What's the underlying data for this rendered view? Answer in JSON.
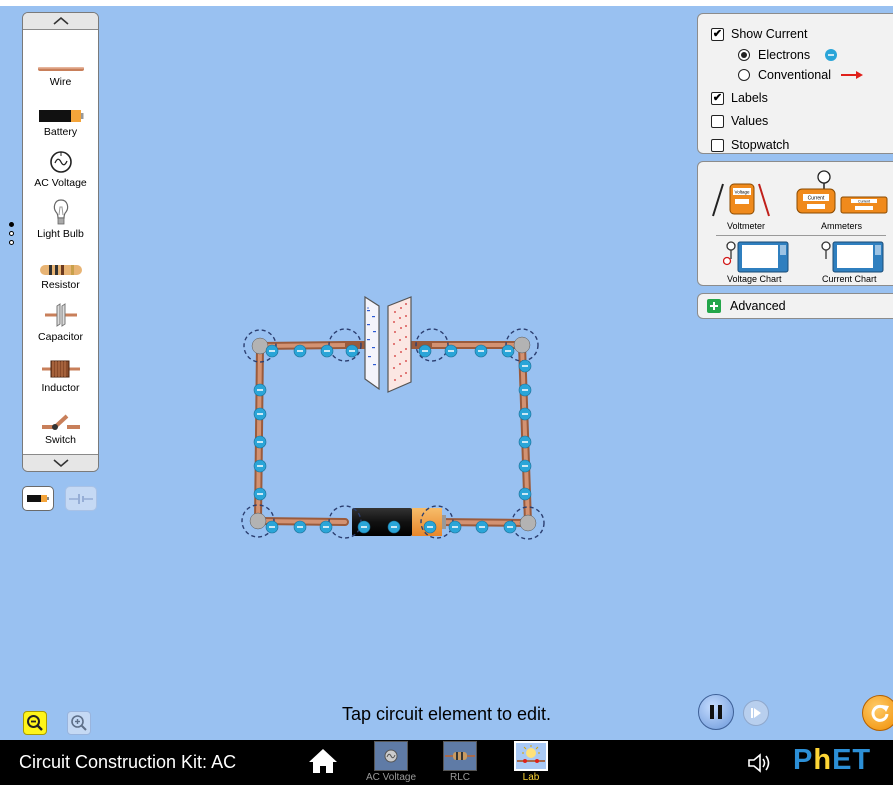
{
  "toolbox": {
    "items": [
      {
        "label": "Wire",
        "icon": "wire-icon"
      },
      {
        "label": "Battery",
        "icon": "battery-icon"
      },
      {
        "label": "AC Voltage",
        "icon": "ac-voltage-icon"
      },
      {
        "label": "Light Bulb",
        "icon": "light-bulb-icon"
      },
      {
        "label": "Resistor",
        "icon": "resistor-icon"
      },
      {
        "label": "Capacitor",
        "icon": "capacitor-icon"
      },
      {
        "label": "Inductor",
        "icon": "inductor-icon"
      },
      {
        "label": "Switch",
        "icon": "switch-icon"
      }
    ],
    "page_count": 3,
    "current_page": 1
  },
  "view_panel": {
    "show_current": {
      "label": "Show Current",
      "checked": true
    },
    "electrons": {
      "label": "Electrons",
      "selected": true
    },
    "conventional": {
      "label": "Conventional",
      "selected": false
    },
    "labels": {
      "label": "Labels",
      "checked": true
    },
    "values": {
      "label": "Values",
      "checked": false
    },
    "stopwatch": {
      "label": "Stopwatch",
      "checked": false
    }
  },
  "tools_panel": {
    "voltmeter": "Voltmeter",
    "ammeters": "Ammeters",
    "voltage_chart": "Voltage Chart",
    "current_chart": "Current Chart",
    "voltmeter_readout": "Voltage",
    "ammeter_readout": "Current"
  },
  "advanced": {
    "label": "Advanced"
  },
  "hint": "Tap circuit element to edit.",
  "colors": {
    "play_area": "#99c1f1",
    "wire": "#c87f5a",
    "electron": "#2aa5d8",
    "accent_yellow": "#fdd536",
    "phet_blue": "#2c8fd6"
  },
  "navbar": {
    "title": "Circuit Construction Kit: AC",
    "screens": [
      {
        "label": "AC Voltage",
        "selected": false
      },
      {
        "label": "RLC",
        "selected": false
      },
      {
        "label": "Lab",
        "selected": true
      }
    ],
    "logo_parts": [
      "P",
      "h",
      "ET"
    ]
  }
}
